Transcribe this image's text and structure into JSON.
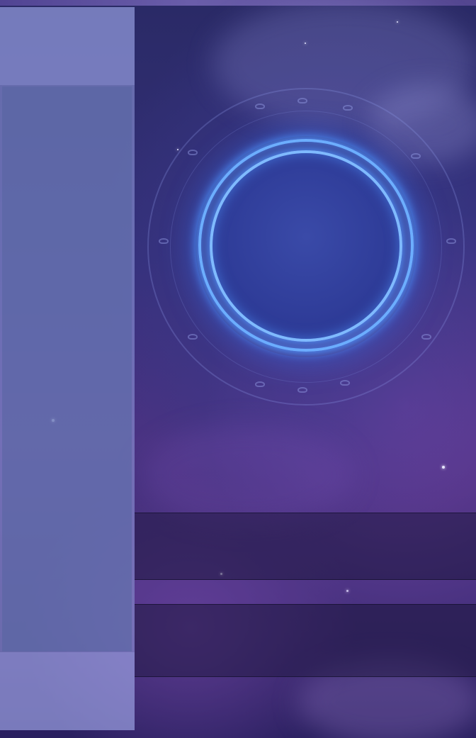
{
  "screen": {
    "width": 672,
    "height": 1041
  },
  "colors": {
    "background": "#35307a",
    "portal_ring": "#6fb0ff",
    "portal_core": "#2d3a96",
    "panel": "#9aa0e1",
    "band": "#231946"
  },
  "icons": {
    "portal": "glowing-portal-icon",
    "runes": "rune-glyph-icon"
  },
  "left_panel": {},
  "bands": {}
}
